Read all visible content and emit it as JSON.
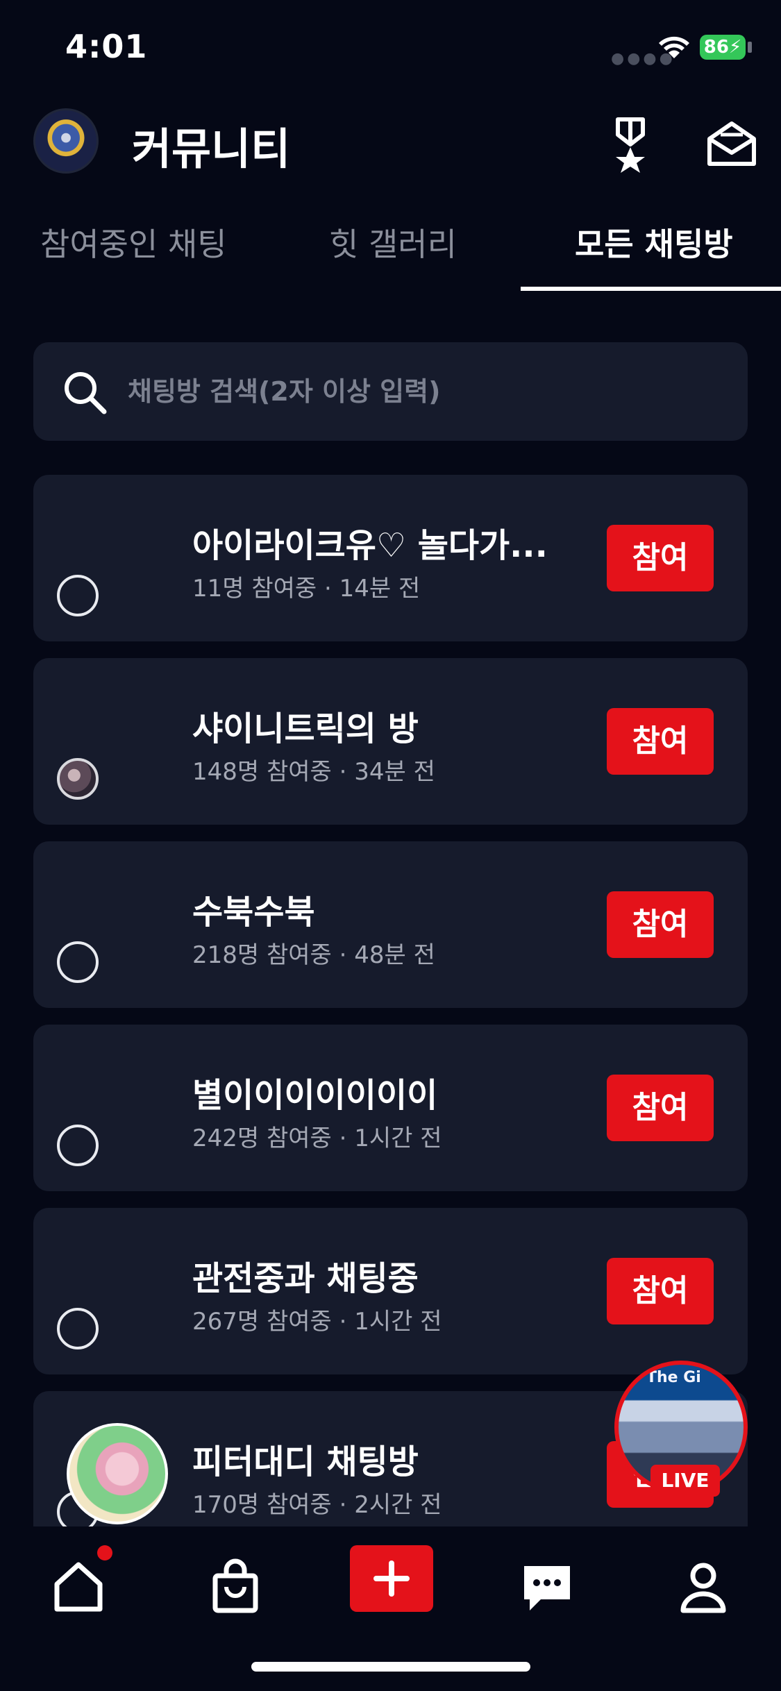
{
  "status_bar": {
    "time": "4:01",
    "battery": "86"
  },
  "header": {
    "title": "커뮤니티"
  },
  "tabs": [
    {
      "label": "참여중인 채팅"
    },
    {
      "label": "힛 갤러리"
    },
    {
      "label": "모든 채팅방"
    }
  ],
  "active_tab": 2,
  "search": {
    "placeholder": "채팅방 검색(2자 이상 입력)"
  },
  "rooms": [
    {
      "title": "아이라이크유♡ 놀다가...",
      "meta": "11명 참여중 · 14분 전",
      "action": "참여"
    },
    {
      "title": "샤이니트릭의 방",
      "meta": "148명 참여중 · 34분 전",
      "action": "참여"
    },
    {
      "title": "수북수북",
      "meta": "218명 참여중 · 48분 전",
      "action": "참여"
    },
    {
      "title": "별이이이이이이이",
      "meta": "242명 참여중 · 1시간 전",
      "action": "참여"
    },
    {
      "title": "관전중과 채팅중",
      "meta": "267명 참여중 · 1시간 전",
      "action": "참여"
    },
    {
      "title": "피터대디 채팅방",
      "meta": "170명 참여중 · 2시간 전",
      "action": "참여"
    }
  ],
  "live": {
    "badge": "LIVE",
    "sign": "The Gi"
  },
  "nav": {
    "items": [
      "home-icon",
      "shop-bag-icon",
      "add-icon",
      "chat-icon",
      "profile-icon"
    ]
  },
  "colors": {
    "accent": "#e4121a",
    "background": "#050816",
    "card": "#161b2c"
  }
}
